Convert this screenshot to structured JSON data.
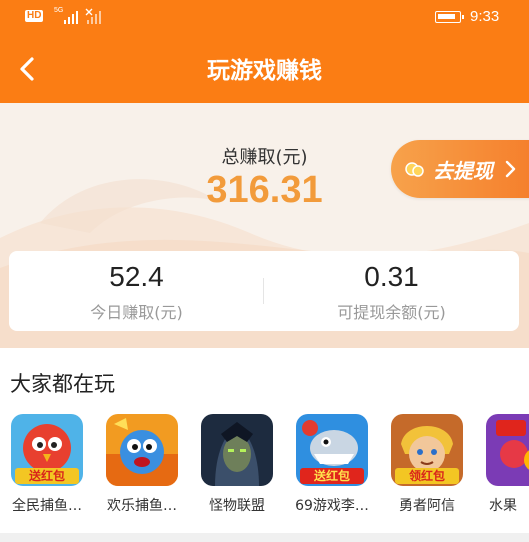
{
  "status": {
    "network": "HD",
    "signal_label": "5G",
    "time": "9:33"
  },
  "header": {
    "title": "玩游戏赚钱"
  },
  "earnings": {
    "total_label": "总赚取(元)",
    "total_value": "316.31",
    "withdraw_label": "去提现"
  },
  "stats": [
    {
      "value": "52.4",
      "label": "今日赚取(元)"
    },
    {
      "value": "0.31",
      "label": "可提现余额(元)"
    }
  ],
  "games": {
    "title": "大家都在玩",
    "items": [
      {
        "name": "全民捕鱼…",
        "icon": "red-bird-icon"
      },
      {
        "name": "欢乐捕鱼…",
        "icon": "blue-fish-icon"
      },
      {
        "name": "怪物联盟",
        "icon": "dark-warrior-icon"
      },
      {
        "name": "69游戏李…",
        "icon": "shark-icon"
      },
      {
        "name": "勇者阿信",
        "icon": "hero-icon"
      },
      {
        "name": "水果",
        "icon": "fruit-icon"
      }
    ],
    "badges": [
      "送红包",
      "领红包"
    ]
  },
  "colors": {
    "accent": "#fb7d14",
    "amount": "#f29b3b",
    "background": "#f3f3f3"
  }
}
